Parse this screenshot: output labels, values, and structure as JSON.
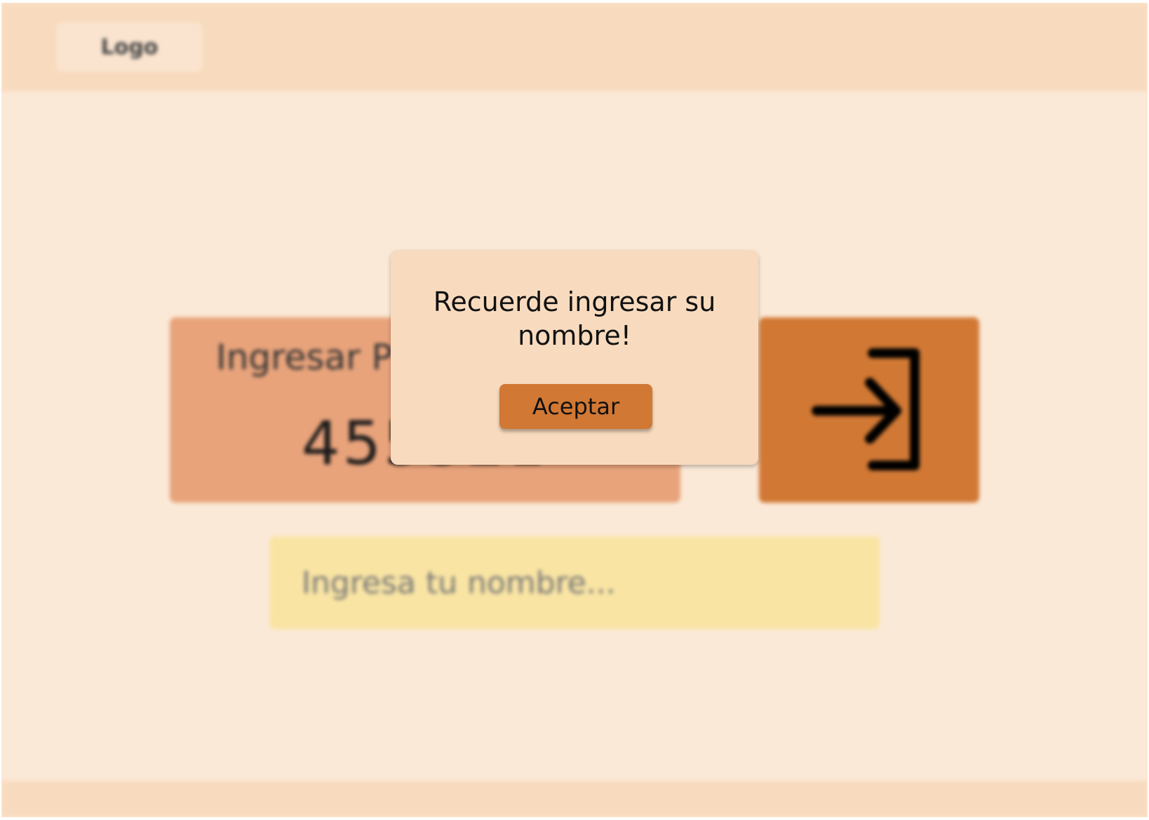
{
  "header": {
    "logo_label": "Logo"
  },
  "pin_card": {
    "title": "Ingresar PIN",
    "value": "455321"
  },
  "enter_button": {
    "icon": "login-icon"
  },
  "name_input": {
    "placeholder": "Ingresa tu nombre...",
    "value": ""
  },
  "dialog": {
    "message": "Recuerde ingresar su nombre!",
    "accept_label": "Aceptar"
  },
  "colors": {
    "background": "#fbe9d7",
    "header": "#f8dbbe",
    "pin_card": "#e8a37b",
    "accent": "#d17834",
    "input": "#f9e4a3"
  }
}
